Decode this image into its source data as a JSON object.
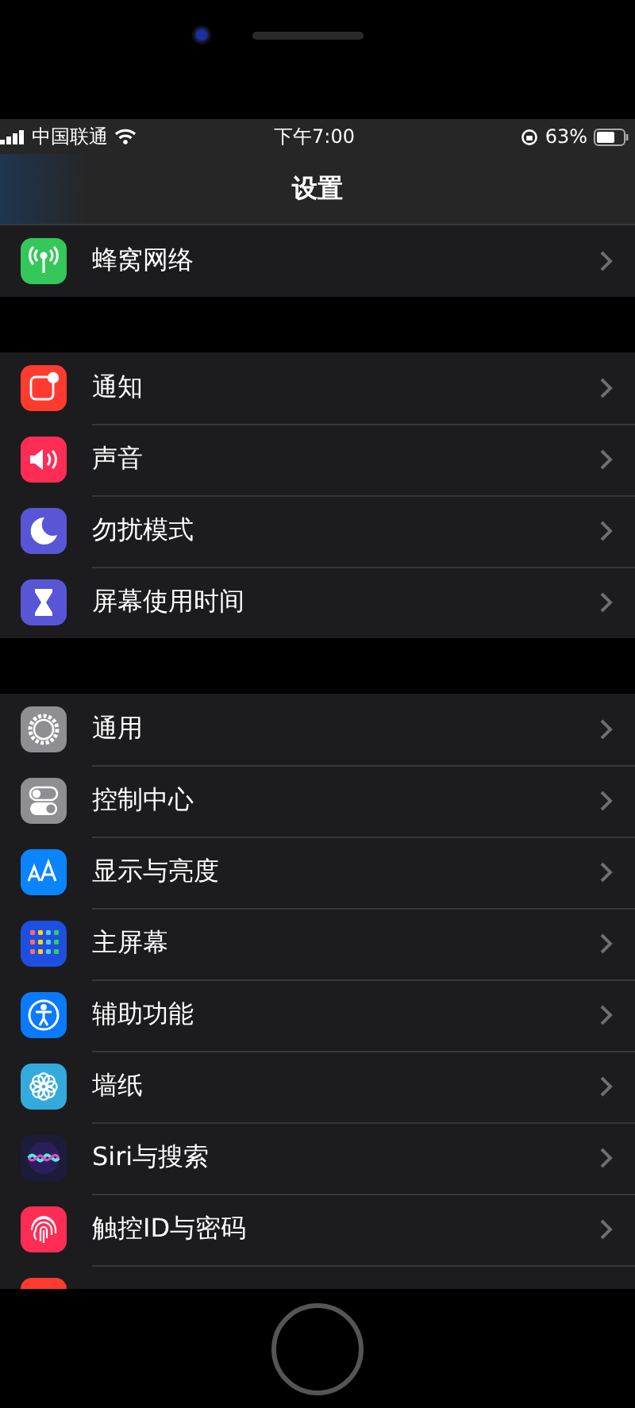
{
  "status_bar": {
    "carrier": "中国联通",
    "time": "下午7:00",
    "battery": "63%"
  },
  "nav": {
    "title": "设置"
  },
  "groups": [
    {
      "items": [
        {
          "label": "蜂窝网络",
          "kind": "antenna",
          "color": "#34c759"
        }
      ]
    },
    {
      "items": [
        {
          "label": "通知",
          "kind": "notification",
          "color": "#ff3b30"
        },
        {
          "label": "声音",
          "kind": "speaker",
          "color": "#ff2d55"
        },
        {
          "label": "勿扰模式",
          "kind": "moon",
          "color": "#5856d6"
        },
        {
          "label": "屏幕使用时间",
          "kind": "hourglass",
          "color": "#5856d6"
        }
      ]
    },
    {
      "items": [
        {
          "label": "通用",
          "kind": "gear",
          "color": "#8e8e93"
        },
        {
          "label": "控制中心",
          "kind": "toggles",
          "color": "#8e8e93"
        },
        {
          "label": "显示与亮度",
          "kind": "text-size",
          "color": "#0a84ff"
        },
        {
          "label": "主屏幕",
          "kind": "grid",
          "color": "#1f4fe0"
        },
        {
          "label": "辅助功能",
          "kind": "accessibility",
          "color": "#0a7aff"
        },
        {
          "label": "墙纸",
          "kind": "flower",
          "color": "#34aadc"
        },
        {
          "label": "Siri与搜索",
          "kind": "siri",
          "color": "#1c1c3a"
        },
        {
          "label": "触控ID与密码",
          "kind": "fingerprint",
          "color": "#ff2d55"
        },
        {
          "kind": "blank",
          "color": "#ff3b30"
        }
      ]
    }
  ]
}
